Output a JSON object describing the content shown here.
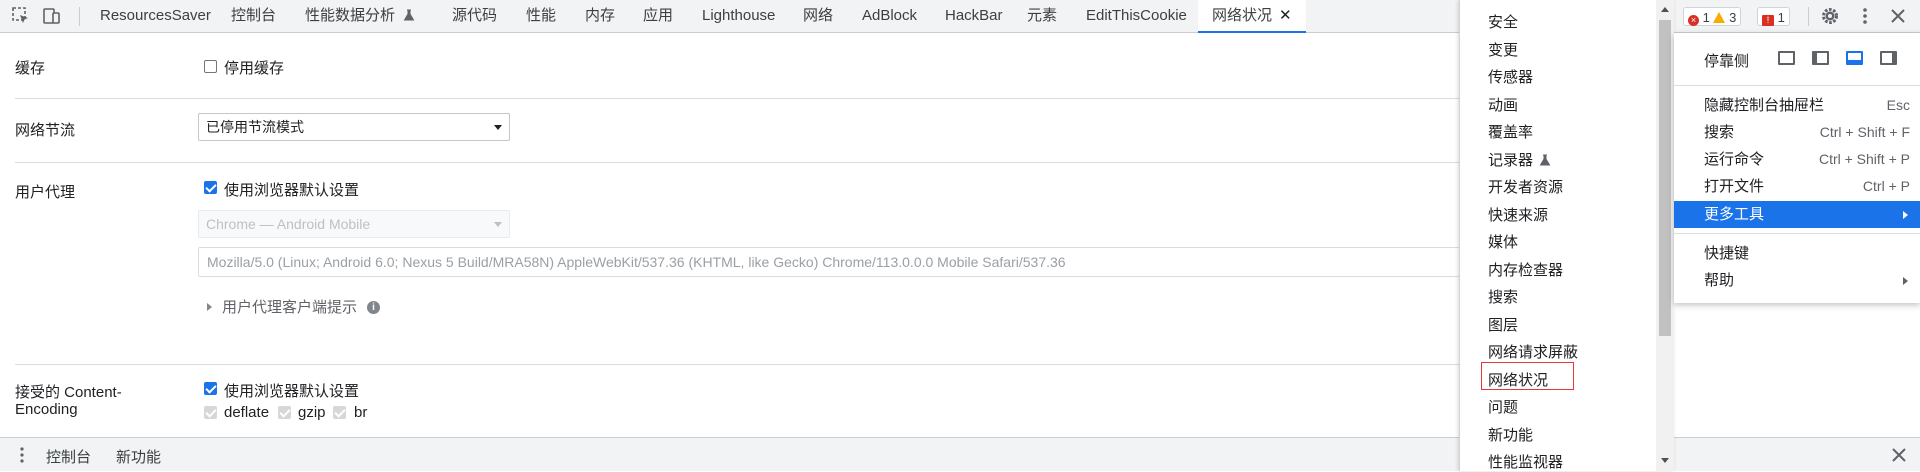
{
  "tabbar": {
    "tabs": [
      {
        "label": "ResourcesSaver"
      },
      {
        "label": "控制台"
      },
      {
        "label": "性能数据分析"
      },
      {
        "label": "源代码"
      },
      {
        "label": "性能"
      },
      {
        "label": "内存"
      },
      {
        "label": "应用"
      },
      {
        "label": "Lighthouse"
      },
      {
        "label": "网络"
      },
      {
        "label": "AdBlock"
      },
      {
        "label": "HackBar"
      },
      {
        "label": "元素"
      },
      {
        "label": "EditThisCookie"
      },
      {
        "label": "网络状况",
        "active": true
      }
    ],
    "errors": "1",
    "warnings": "3",
    "issues": "1"
  },
  "panel": {
    "cache": {
      "label": "缓存",
      "checkbox_label": "停用缓存",
      "checked": false
    },
    "throttling": {
      "label": "网络节流",
      "value": "已停用节流模式"
    },
    "user_agent": {
      "label": "用户代理",
      "checkbox_label": "使用浏览器默认设置",
      "checked": true,
      "preset": "Chrome — Android Mobile",
      "string": "Mozilla/5.0 (Linux; Android 6.0; Nexus 5 Build/MRA58N) AppleWebKit/537.36 (KHTML, like Gecko) Chrome/113.0.0.0 Mobile Safari/537.36",
      "client_hints": "用户代理客户端提示"
    },
    "encoding": {
      "label_line1": "接受的 Content-",
      "label_line2": "Encoding",
      "checkbox_label": "使用浏览器默认设置",
      "checked": true,
      "options": [
        "deflate",
        "gzip",
        "br"
      ]
    }
  },
  "drawer": {
    "tabs": [
      "控制台",
      "新功能"
    ]
  },
  "more_tools_menu": {
    "items": [
      "安全",
      "变更",
      "传感器",
      "动画",
      "覆盖率",
      "记录器",
      "开发者资源",
      "快速来源",
      "媒体",
      "内存检查器",
      "搜索",
      "图层",
      "网络请求屏蔽",
      "网络状况",
      "问题",
      "新功能",
      "性能监视器"
    ],
    "highlighted": "网络状况"
  },
  "main_menu": {
    "dock_label": "停靠侧",
    "items": [
      {
        "label": "隐藏控制台抽屉栏",
        "shortcut": "Esc"
      },
      {
        "label": "搜索",
        "shortcut": "Ctrl + Shift + F"
      },
      {
        "label": "运行命令",
        "shortcut": "Ctrl + Shift + P"
      },
      {
        "label": "打开文件",
        "shortcut": "Ctrl + P"
      },
      {
        "label": "更多工具",
        "shortcut": "",
        "selected": true
      },
      {
        "label": "快捷键",
        "shortcut": ""
      },
      {
        "label": "帮助",
        "shortcut": ""
      }
    ]
  },
  "colors": {
    "accent": "#1a73e8",
    "highlight_box": "#e53935",
    "error": "#d93025",
    "warning": "#f9ab00"
  }
}
